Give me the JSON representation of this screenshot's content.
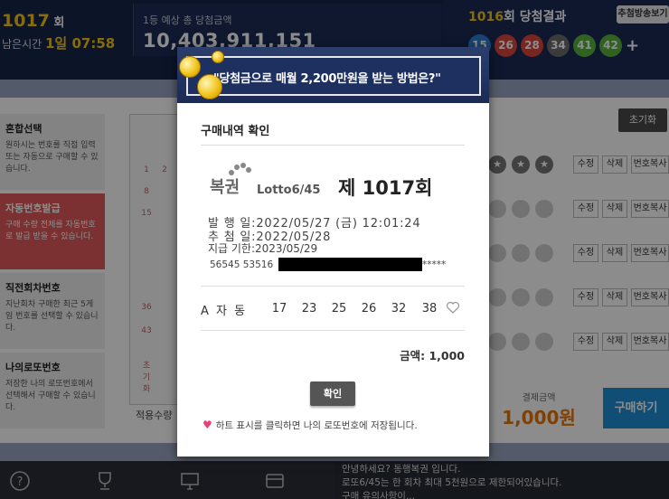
{
  "header": {
    "round_label_pre": "",
    "round_num": "1017",
    "round_suffix": "회",
    "remain_label": "남은시간",
    "remain_value": "1일 07:58",
    "prize_label": "1등 예상 총 당첨금액",
    "prize_amount": "10,403,911,151",
    "result_round": "1016",
    "result_suffix": "회 당첨결과",
    "live_btn": "추첨방송보기",
    "balls": [
      {
        "n": "15",
        "color": "#2f7fd0"
      },
      {
        "n": "26",
        "color": "#d9453f"
      },
      {
        "n": "28",
        "color": "#d9453f"
      },
      {
        "n": "34",
        "color": "#6c6c6c"
      },
      {
        "n": "41",
        "color": "#5ab33e"
      },
      {
        "n": "42",
        "color": "#5ab33e"
      }
    ],
    "plus": "+"
  },
  "side_menu": [
    {
      "title": "혼합선택",
      "desc": "원하시는 번호를 직접 입력 또는 자동으로 구매할 수 있습니다."
    },
    {
      "title": "자동번호발급",
      "desc": "구매 수량 전체를 자동번호로 발급 받을 수 있습니다."
    },
    {
      "title": "직전회차번호",
      "desc": "지난회차 구매한 최근 5게임 번호를 선택할 수 있습니다."
    },
    {
      "title": "나의로또번호",
      "desc": "저장한 나의 로또번호에서 선택해서 구매할 수 있습니다."
    }
  ],
  "main": {
    "reset_btn": "초기화",
    "row_edit": "수정",
    "row_delete": "삭제",
    "row_copy": "번호복사",
    "pay_label": "결제금액",
    "pay_amount": "1,000원",
    "buy_btn": "구매하기",
    "apply_label": "적용수량"
  },
  "notice": {
    "line1": "안녕하세요? 동행복권 입니다.",
    "line2": "로또6/45는 한 회차 최대 5천원으로 제한되어있습니다.",
    "line3": "구매 유의사항이..."
  },
  "modal": {
    "banner": "\"당첨금으로 매월 2,200만원을 받는 방법은?\"",
    "title": "구매내역 확인",
    "logo_kor": "복권",
    "logo_lotto": "Lotto6/45",
    "round": "제 1017회",
    "issue_line": "발 행 일:2022/05/27 (금) 12:01:24",
    "draw_line": "추 첨 일:2022/05/28",
    "deadline_line": "지급 기한:2023/05/29",
    "serial_prefix": "56545 53516",
    "serial_suffix": "*****",
    "game_label": "A 자  동",
    "game_numbers": [
      "17",
      "23",
      "25",
      "26",
      "32",
      "38"
    ],
    "total": "금액: 1,000",
    "ok_btn": "확인",
    "hint": "하트 표시를 클릭하면 나의 로또번호에 저장됩니다."
  }
}
